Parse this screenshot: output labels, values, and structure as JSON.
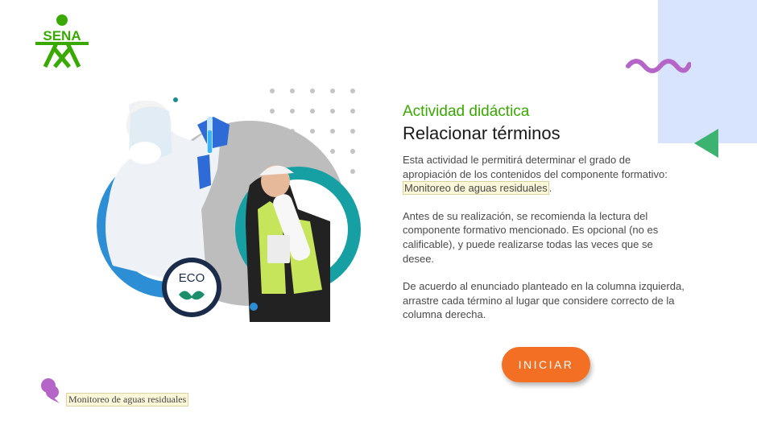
{
  "brand": {
    "logo_text": "SENA",
    "logo_color": "#39a900"
  },
  "activity": {
    "eyebrow": "Actividad didáctica",
    "title": "Relacionar términos",
    "intro": "Esta actividad le permitirá determinar el grado de apropiación de los contenidos del componente formativo: ",
    "component_name": "Monitoreo de aguas residuales",
    "intro_end": ".",
    "paragraph_2": "Antes de su realización, se recomienda la lectura del componente formativo mencionado. Es opcional (no es calificable), y puede realizarse todas las veces que se desee.",
    "paragraph_3": "De acuerdo al enunciado planteado en la columna izquierda, arrastre cada término al lugar que considere correcto de la columna derecha."
  },
  "start_button": {
    "label": "INICIAR"
  },
  "illustration": {
    "badge_text": "ECO"
  },
  "footer": {
    "label": "Monitoreo de aguas residuales"
  },
  "colors": {
    "accent_green": "#39a900",
    "button_orange": "#f26f23",
    "wave_purple": "#b565c7",
    "triangle_green": "#3cb371",
    "bg_block": "#d8e3fd"
  },
  "icons": {
    "logo": "sena-logo-icon",
    "wave": "wave-decoration-icon",
    "triangle": "triangle-decoration-icon",
    "footer": "speech-bubble-icon"
  }
}
